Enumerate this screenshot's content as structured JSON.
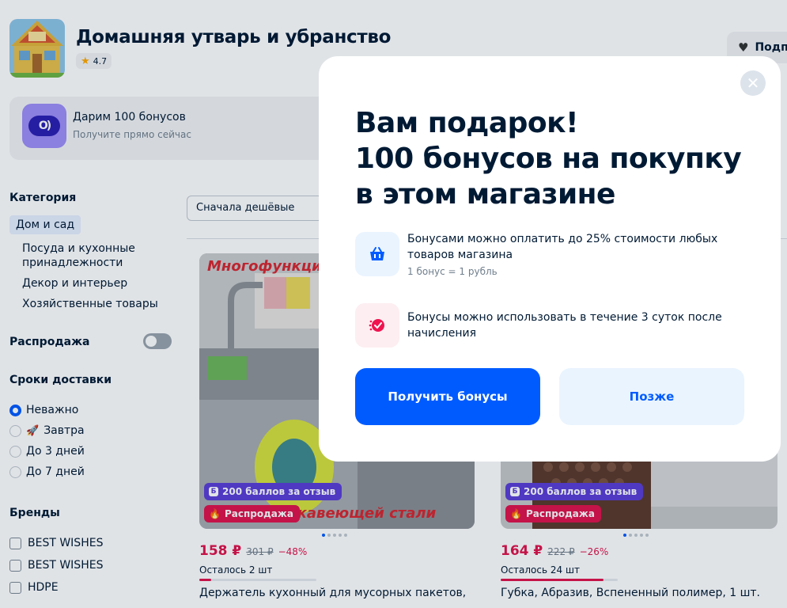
{
  "header": {
    "store_name": "Домашняя утварь и убранство",
    "rating": "4.7",
    "subscribe_label": "Подп"
  },
  "promo": {
    "title": "Дарим 100 бонусов",
    "subtitle": "Получите прямо сейчас"
  },
  "sidebar": {
    "category_heading": "Категория",
    "category_active": "Дом и сад",
    "categories": [
      "Посуда и кухонные",
      "принадлежности",
      "Декор и интерьер",
      "Хозяйственные товары"
    ],
    "sale_label": "Распродажа",
    "sale_enabled": false,
    "delivery_heading": "Сроки доставки",
    "delivery_options": [
      "Неважно",
      "Завтра",
      "До 3 дней",
      "До 7 дней"
    ],
    "delivery_selected": "Неважно",
    "brands_heading": "Бренды",
    "brands": [
      "BEST WISHES",
      "BEST WISHES",
      "HDPE"
    ]
  },
  "sort": {
    "selected": "Сначала дешёвые"
  },
  "products": [
    {
      "image_text_top": "Многофункци",
      "image_text_bottom": "жавеющей стали",
      "points_badge": "200 баллов за отзыв",
      "sale_badge": "Распродажа",
      "price": "158 ₽",
      "old_price": "301 ₽",
      "discount": "−48%",
      "stock": "Осталось 2 шт",
      "stock_fraction": 0.1,
      "name": "Держатель кухонный для мусорных пакетов,"
    },
    {
      "points_badge": "200 баллов за отзыв",
      "sale_badge": "Распродажа",
      "price": "164 ₽",
      "old_price": "222 ₽",
      "discount": "−26%",
      "stock": "Осталось 24 шт",
      "stock_fraction": 0.88,
      "name": "Губка, Абразив, Вспененный полимер, 1 шт."
    }
  ],
  "modal": {
    "title_lines": [
      "Вам подарок!",
      "100 бонусов на покупку",
      "в этом магазине"
    ],
    "feature1_line1": "Бонусами можно оплатить до 25% стоимости любых",
    "feature1_line2": "товаров магазина",
    "feature1_note": "1 бонус = 1 рубль",
    "feature1_icon": "basket-icon",
    "feature2_line1": "Бонусы можно использовать в течение 3 суток после",
    "feature2_line2": "начисления",
    "feature2_icon": "timer-icon",
    "primary_button": "Получить бонусы",
    "secondary_button": "Позже",
    "close_icon": "close-icon"
  },
  "colors": {
    "accent": "#005bff",
    "sale": "#e0134c",
    "points": "#5a3ed6",
    "light_blue": "#eaf4ff"
  }
}
